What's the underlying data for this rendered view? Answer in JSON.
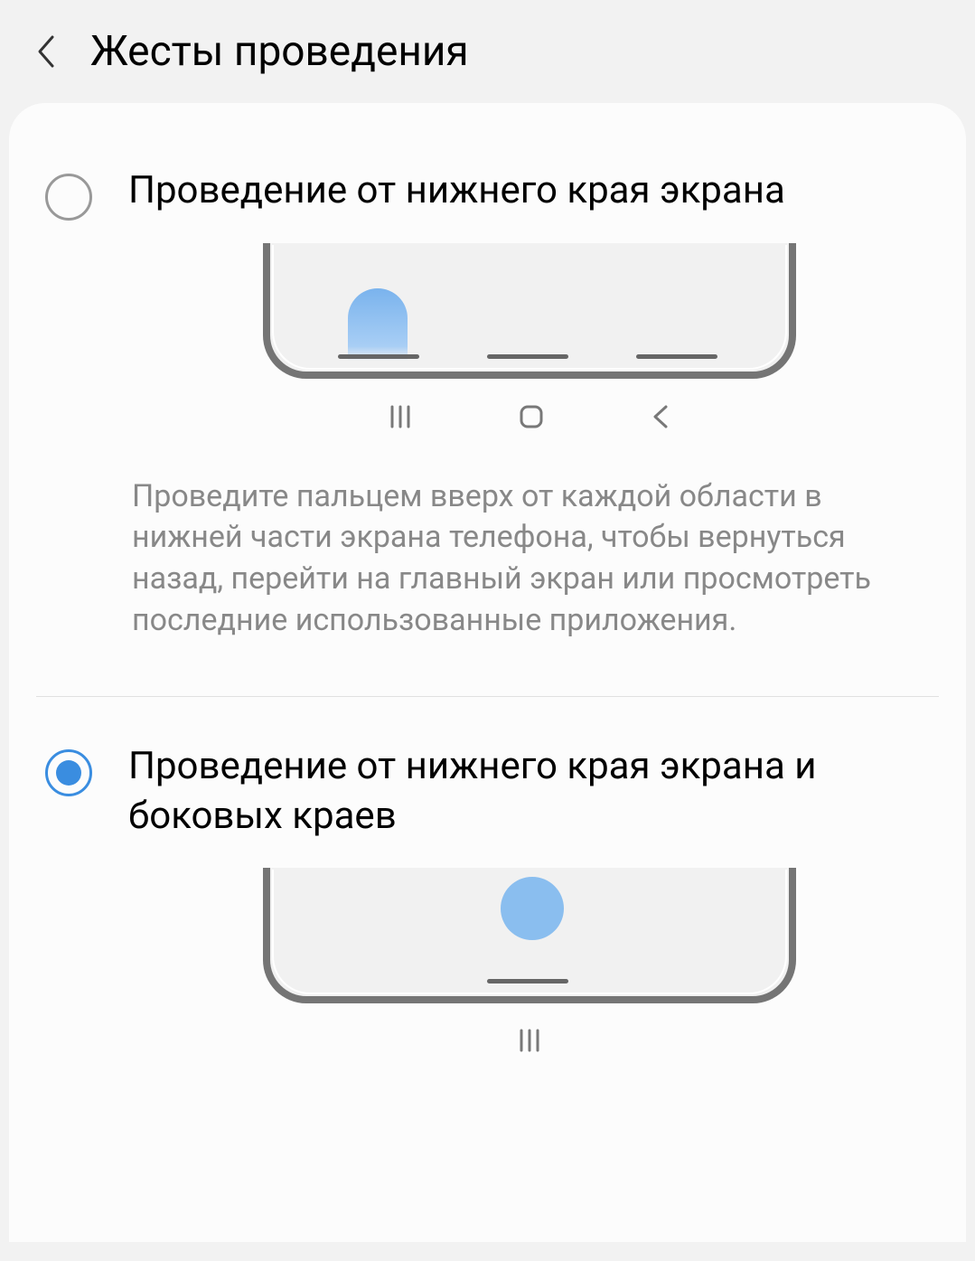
{
  "header": {
    "title": "Жесты проведения"
  },
  "options": [
    {
      "label": "Проведение от нижнего края экрана",
      "description": "Проведите пальцем вверх от каждой области в нижней части экрана телефона, чтобы вернуться назад, перейти на главный экран или просмотреть последние использованные приложения.",
      "selected": false
    },
    {
      "label": "Проведение от нижнего края экрана и боковых краев",
      "description": "",
      "selected": true
    }
  ]
}
